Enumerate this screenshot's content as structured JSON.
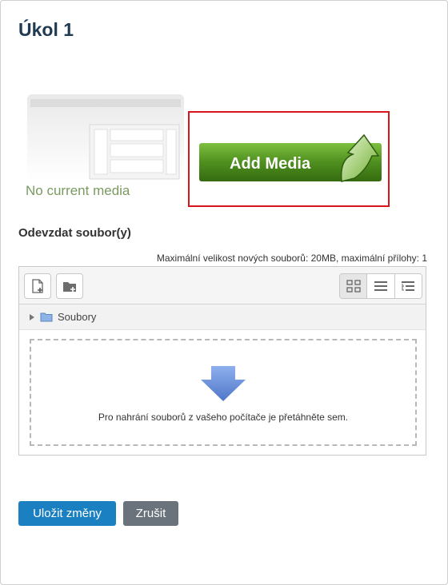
{
  "page": {
    "title": "Úkol 1"
  },
  "media": {
    "no_media_text": "No current media",
    "add_media_label": "Add Media"
  },
  "submission": {
    "section_label": "Odevzdat soubor(y)",
    "max_note": "Maximální velikost nových souborů: 20MB, maximální přílohy: 1"
  },
  "filepicker": {
    "toolbar": {
      "add_file_icon": "add-file-icon",
      "create_folder_icon": "create-folder-icon",
      "view_icons": [
        "grid-view-icon",
        "list-view-icon",
        "tree-view-icon"
      ]
    },
    "path_label": "Soubory",
    "drop_text": "Pro nahrání souborů z vašeho počítače je přetáhněte sem."
  },
  "actions": {
    "save_label": "Uložit změny",
    "cancel_label": "Zrušit"
  },
  "colors": {
    "title": "#1f3a52",
    "no_media": "#7a9a60",
    "highlight_border": "#d9141b",
    "add_media_green": "#4f8f1f",
    "primary": "#1b80c2",
    "secondary": "#6a737b",
    "drop_arrow": "#6a8fd8"
  }
}
